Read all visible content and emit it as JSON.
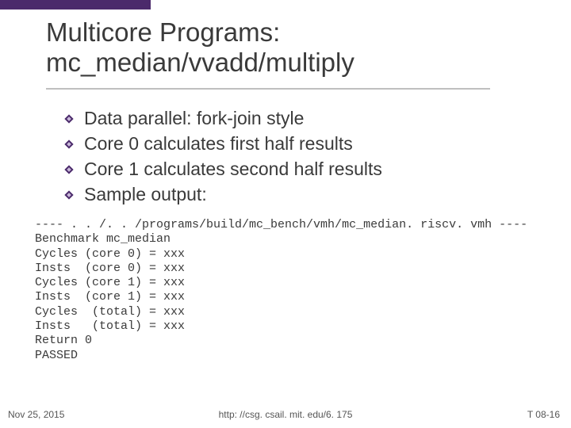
{
  "title": "Multicore Programs: mc_median/vvadd/multiply",
  "bullets": [
    "Data parallel: fork-join style",
    "Core 0 calculates first half results",
    "Core 1 calculates second half results",
    "Sample output:"
  ],
  "code_lines": [
    "---- . . /. . /programs/build/mc_bench/vmh/mc_median. riscv. vmh ----",
    "Benchmark mc_median",
    "Cycles (core 0) = xxx",
    "Insts  (core 0) = xxx",
    "Cycles (core 1) = xxx",
    "Insts  (core 1) = xxx",
    "Cycles  (total) = xxx",
    "Insts   (total) = xxx",
    "Return 0",
    "PASSED"
  ],
  "footer": {
    "date": "Nov 25, 2015",
    "url": "http: //csg. csail. mit. edu/6. 175",
    "page": "T 08-16"
  }
}
